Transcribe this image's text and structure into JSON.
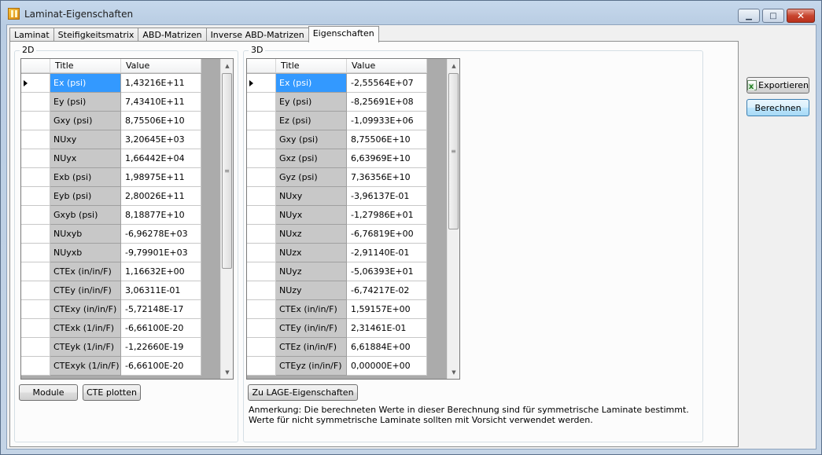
{
  "window": {
    "title": "Laminat-Eigenschaften",
    "min_glyph": "▁",
    "max_glyph": "□",
    "close_glyph": "✕"
  },
  "tabs": [
    {
      "label": "Laminat"
    },
    {
      "label": "Steifigkeitsmatrix"
    },
    {
      "label": "ABD-Matrizen"
    },
    {
      "label": "Inverse ABD-Matrizen"
    },
    {
      "label": "Eigenschaften",
      "active": true
    }
  ],
  "grid2d": {
    "group_label": "2D",
    "col_title": "Title",
    "col_value": "Value",
    "rows": [
      {
        "title": "Ex (psi)",
        "value": "1,43216E+11"
      },
      {
        "title": "Ey (psi)",
        "value": "7,43410E+11"
      },
      {
        "title": "Gxy (psi)",
        "value": "8,75506E+10"
      },
      {
        "title": "NUxy",
        "value": "3,20645E+03"
      },
      {
        "title": "NUyx",
        "value": "1,66442E+04"
      },
      {
        "title": "Exb (psi)",
        "value": "1,98975E+11"
      },
      {
        "title": "Eyb (psi)",
        "value": "2,80026E+11"
      },
      {
        "title": "Gxyb (psi)",
        "value": "8,18877E+10"
      },
      {
        "title": "NUxyb",
        "value": "-6,96278E+03"
      },
      {
        "title": "NUyxb",
        "value": "-9,79901E+03"
      },
      {
        "title": "CTEx (in/in/F)",
        "value": "1,16632E+00"
      },
      {
        "title": "CTEy (in/in/F)",
        "value": "3,06311E-01"
      },
      {
        "title": "CTExy (in/in/F)",
        "value": "-5,72148E-17"
      },
      {
        "title": "CTExk (1/in/F)",
        "value": "-6,66100E-20"
      },
      {
        "title": "CTEyk (1/in/F)",
        "value": "-1,22660E-19"
      },
      {
        "title": "CTExyk (1/in/F)",
        "value": "-6,66100E-20"
      }
    ],
    "module_button": "Module",
    "cte_button": "CTE plotten"
  },
  "grid3d": {
    "group_label": "3D",
    "col_title": "Title",
    "col_value": "Value",
    "rows": [
      {
        "title": "Ex (psi)",
        "value": "-2,55564E+07"
      },
      {
        "title": "Ey (psi)",
        "value": "-8,25691E+08"
      },
      {
        "title": "Ez (psi)",
        "value": "-1,09933E+06"
      },
      {
        "title": "Gxy (psi)",
        "value": "8,75506E+10"
      },
      {
        "title": "Gxz (psi)",
        "value": "6,63969E+10"
      },
      {
        "title": "Gyz (psi)",
        "value": "7,36356E+10"
      },
      {
        "title": "NUxy",
        "value": "-3,96137E-01"
      },
      {
        "title": "NUyx",
        "value": "-1,27986E+01"
      },
      {
        "title": "NUxz",
        "value": "-6,76819E+00"
      },
      {
        "title": "NUzx",
        "value": "-2,91140E-01"
      },
      {
        "title": "NUyz",
        "value": "-5,06393E+01"
      },
      {
        "title": "NUzy",
        "value": "-6,74217E-02"
      },
      {
        "title": "CTEx (in/in/F)",
        "value": "1,59157E+00"
      },
      {
        "title": "CTEy (in/in/F)",
        "value": "2,31461E-01"
      },
      {
        "title": "CTEz (in/in/F)",
        "value": "6,61884E+00"
      },
      {
        "title": "CTEyz (in/in/F)",
        "value": "0,00000E+00"
      }
    ],
    "lage_button": "Zu LAGE-Eigenschaften"
  },
  "note": "Anmerkung: Die berechneten Werte in dieser Berechnung sind für symmetrische Laminate bestimmt. Werte für nicht symmetrische Laminate sollten mit Vorsicht verwendet werden.",
  "side_buttons": {
    "export": "Exportieren",
    "calculate": "Berechnen"
  },
  "icons": {
    "app": "laminate-app-icon",
    "export": "excel-icon",
    "scroll_up": "▲",
    "scroll_down": "▼",
    "thumb_grip": "≡"
  }
}
